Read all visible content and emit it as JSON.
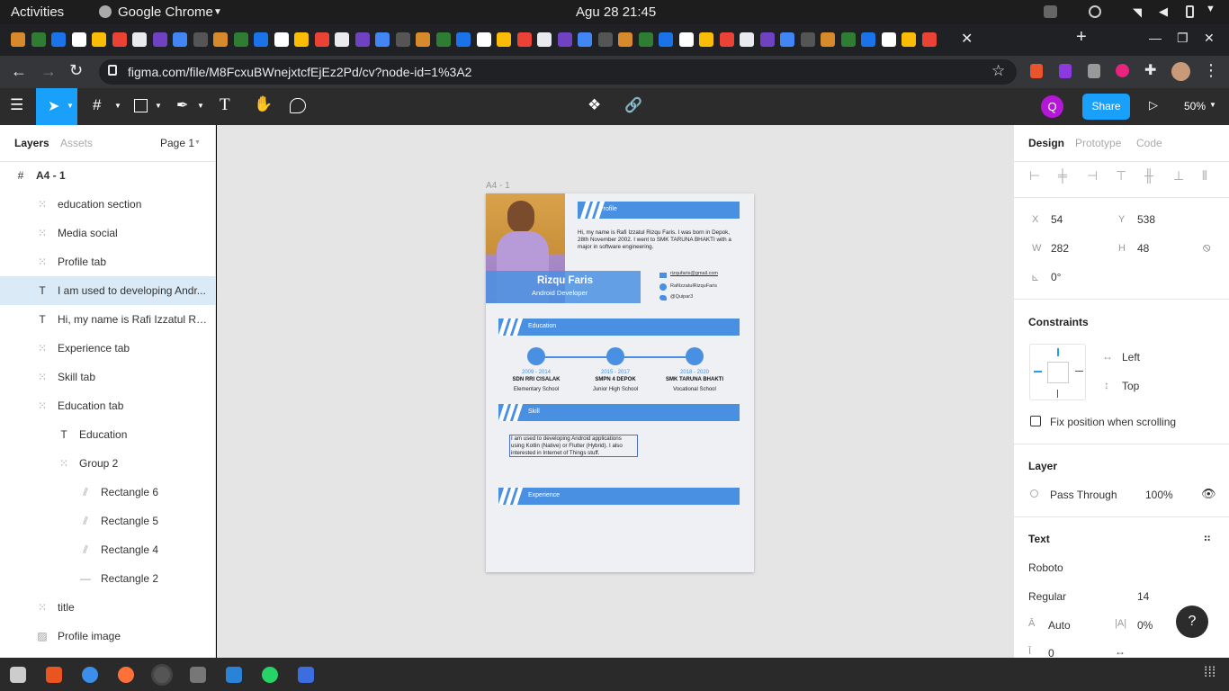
{
  "system": {
    "activities": "Activities",
    "app": "Google Chrome",
    "clock": "Agu 28  21:45"
  },
  "browser": {
    "url": "figma.com/file/M8FcxuBWnejxtcfEjEz2Pd/cv?node-id=1%3A2"
  },
  "figma": {
    "avatar_letter": "Q",
    "share": "Share",
    "zoom": "50%",
    "left_tabs": {
      "layers": "Layers",
      "assets": "Assets",
      "page": "Page 1"
    },
    "layers": [
      {
        "name": "A4 - 1",
        "type": "frame",
        "indent": 0,
        "selected": false
      },
      {
        "name": "education section",
        "type": "group",
        "indent": 1,
        "selected": false
      },
      {
        "name": "Media social",
        "type": "group",
        "indent": 1,
        "selected": false
      },
      {
        "name": "Profile tab",
        "type": "group",
        "indent": 1,
        "selected": false
      },
      {
        "name": "I am used to developing Andr...",
        "type": "text",
        "indent": 1,
        "selected": true
      },
      {
        "name": "Hi, my name is Rafi Izzatul Riz...",
        "type": "text",
        "indent": 1,
        "selected": false
      },
      {
        "name": "Experience tab",
        "type": "group",
        "indent": 1,
        "selected": false
      },
      {
        "name": "Skill tab",
        "type": "group",
        "indent": 1,
        "selected": false
      },
      {
        "name": "Education tab",
        "type": "group",
        "indent": 1,
        "selected": false
      },
      {
        "name": "Education",
        "type": "text",
        "indent": 2,
        "selected": false
      },
      {
        "name": "Group 2",
        "type": "group",
        "indent": 2,
        "selected": false
      },
      {
        "name": "Rectangle 6",
        "type": "rect",
        "indent": 3,
        "selected": false
      },
      {
        "name": "Rectangle 5",
        "type": "rect",
        "indent": 3,
        "selected": false
      },
      {
        "name": "Rectangle 4",
        "type": "rect",
        "indent": 3,
        "selected": false
      },
      {
        "name": "Rectangle 2",
        "type": "line",
        "indent": 3,
        "selected": false
      },
      {
        "name": "title",
        "type": "group",
        "indent": 1,
        "selected": false
      },
      {
        "name": "Profile image",
        "type": "image",
        "indent": 1,
        "selected": false
      }
    ],
    "right_tabs": {
      "design": "Design",
      "prototype": "Prototype",
      "code": "Code"
    },
    "props": {
      "x_label": "X",
      "x": "54",
      "y_label": "Y",
      "y": "538",
      "w_label": "W",
      "w": "282",
      "h_label": "H",
      "h": "48",
      "rotation": "0°"
    },
    "constraints": {
      "title": "Constraints",
      "horizontal": "Left",
      "vertical": "Top",
      "fix_scroll": "Fix position when scrolling"
    },
    "layer_section": {
      "title": "Layer",
      "blend": "Pass Through",
      "opacity": "100%"
    },
    "text_section": {
      "title": "Text",
      "font": "Roboto",
      "weight": "Regular",
      "size": "14",
      "line_height": "Auto",
      "letter_spacing": "0%",
      "paragraph": "0"
    },
    "help": "?"
  },
  "cv": {
    "frame_label": "A4 - 1",
    "profile_title": "Profile",
    "profile_text": "Hi, my name is Rafi Izzatul Rizqu Faris. I was born in Depok, 28th November 2002. I went to SMK TARUNA BHAKTI with a major in software engineering.",
    "name": "Rizqu Faris",
    "role": "Android Developer",
    "email": "rizqufaris@gmail.com",
    "github": "RafiIzzatulRizquFaris",
    "twitter": "@Quipar3",
    "education_title": "Education",
    "education": [
      {
        "years": "2009 - 2014",
        "school": "SDN RRI CISALAK",
        "level": "Elementary School"
      },
      {
        "years": "2015 - 2017",
        "school": "SMPN 4 DEPOK",
        "level": "Junior High School"
      },
      {
        "years": "2018 - 2020",
        "school": "SMK TARUNA BHAKTI",
        "level": "Vocational School"
      }
    ],
    "skill_title": "Skill",
    "skill_text": "I am used to developing Android applications using Kotlin (Native) or Flutter (Hybrid). I also interested in Internet of Things stuff.",
    "experience_title": "Experience"
  },
  "colors": {
    "accent": "#4a90e2",
    "figma_blue": "#18a0fb",
    "avatar": "#b517d8"
  }
}
